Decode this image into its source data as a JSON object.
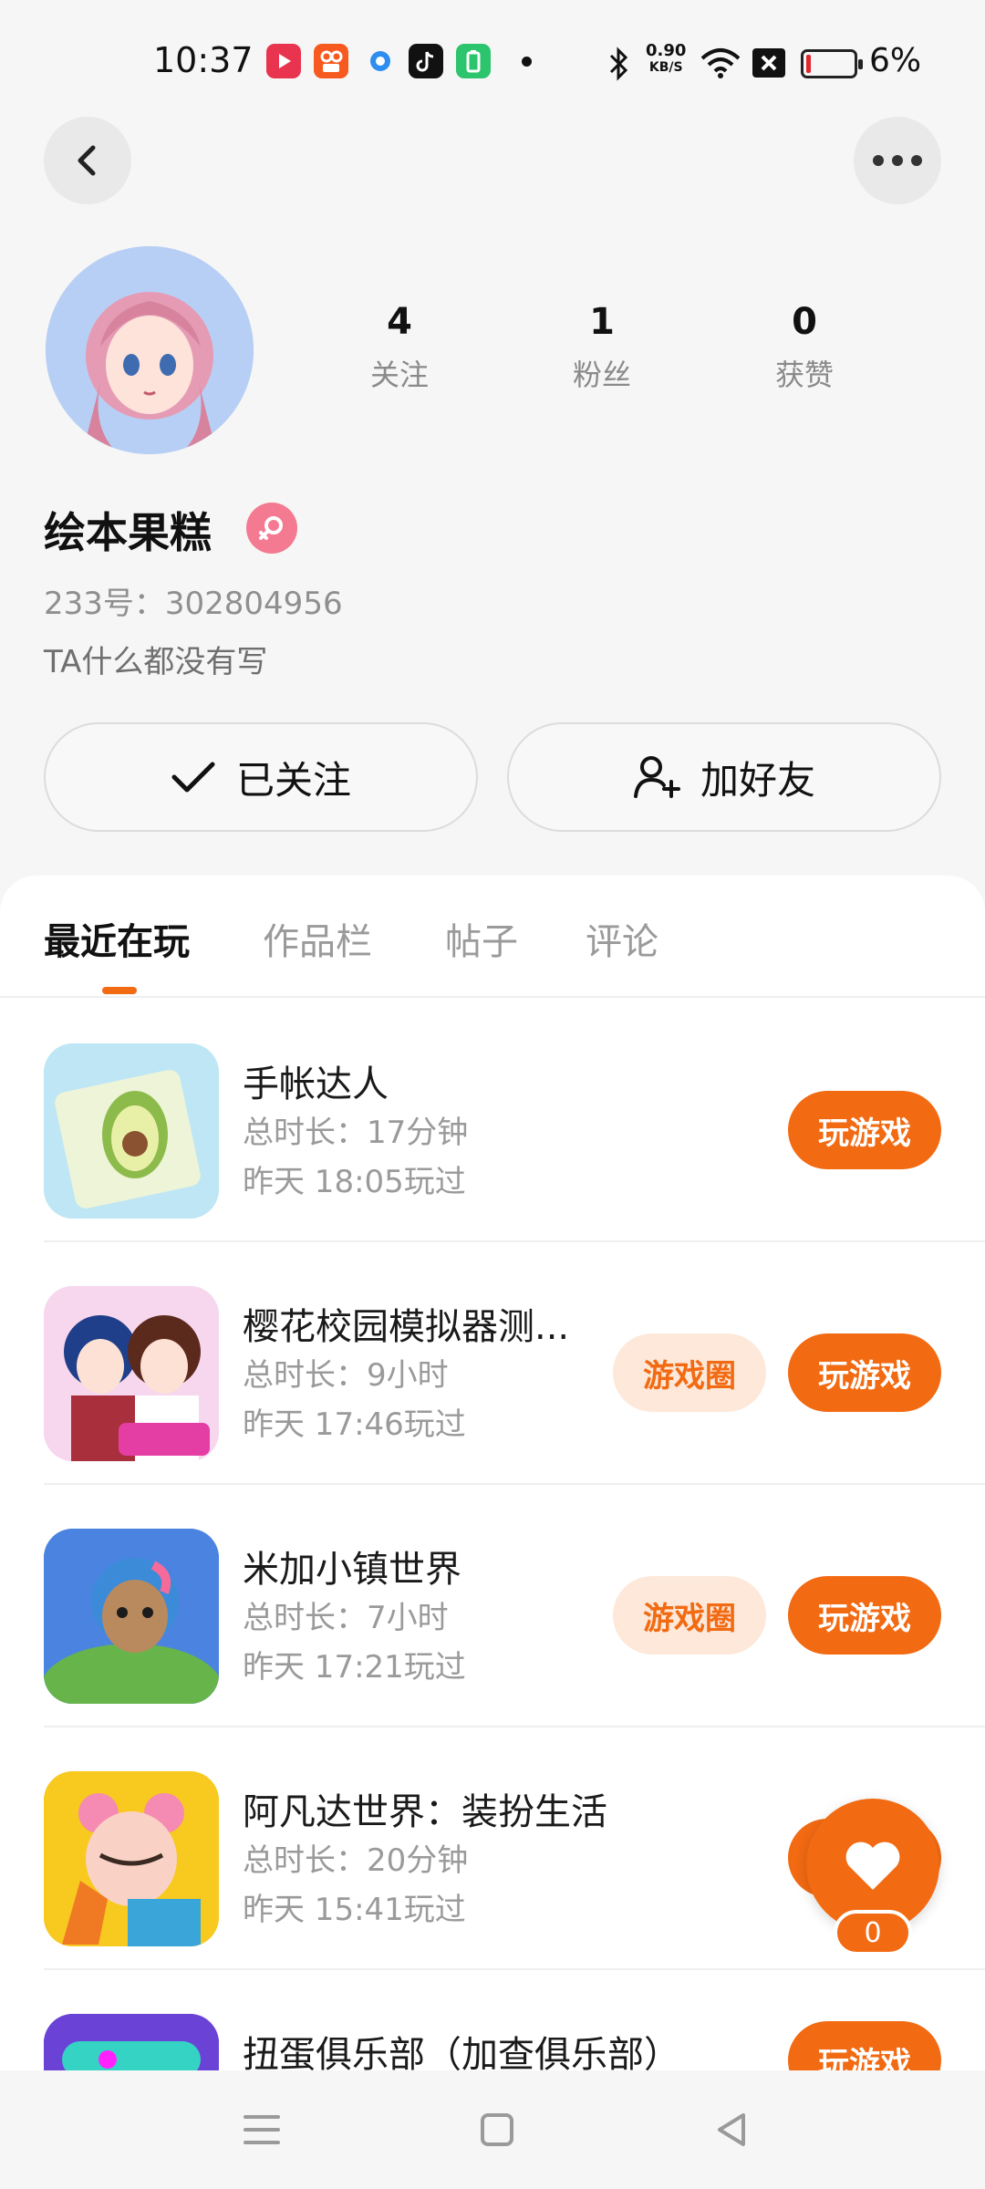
{
  "status_bar": {
    "time": "10:37",
    "net_speed_value": "0.90",
    "net_speed_unit": "KB/S",
    "battery_percent": "6%",
    "battery_level": 0.06,
    "icons": [
      "bluetooth-icon",
      "wifi-icon",
      "sim-off-icon",
      "battery-icon"
    ],
    "colors": {
      "battery_low": "#e0262c"
    }
  },
  "header": {
    "back_icon": "chevron-left-icon",
    "more_icon": "more-dots-icon"
  },
  "profile": {
    "name": "绘本果糕",
    "gender_icon": "female-icon",
    "uid": "233号：302804956",
    "bio": "TA什么都没有写",
    "stats": [
      {
        "value": "4",
        "label": "关注"
      },
      {
        "value": "1",
        "label": "粉丝"
      },
      {
        "value": "0",
        "label": "获赞"
      }
    ],
    "follow_label": "已关注",
    "add_friend_label": "加好友"
  },
  "tabs": [
    "最近在玩",
    "作品栏",
    "帖子",
    "评论"
  ],
  "active_tab": 0,
  "games": [
    {
      "name": "手帐达人",
      "duration": "总时长：17分钟",
      "last_played": "昨天 18:05玩过",
      "has_circle": false
    },
    {
      "name": "樱花校园模拟器测...",
      "duration": "总时长：9小时",
      "last_played": "昨天 17:46玩过",
      "has_circle": true
    },
    {
      "name": "米加小镇世界",
      "duration": "总时长：7小时",
      "last_played": "昨天 17:21玩过",
      "has_circle": true
    },
    {
      "name": "阿凡达世界：装扮生活",
      "duration": "总时长：20分钟",
      "last_played": "昨天 15:41玩过",
      "has_circle": false
    },
    {
      "name": "扭蛋俱乐部（加查俱乐部）",
      "duration": "",
      "last_played": "",
      "has_circle": false
    }
  ],
  "buttons": {
    "play_label": "玩游戏",
    "circle_label": "游戏圈"
  },
  "like": {
    "count": "0",
    "icon": "heart-icon"
  },
  "colors": {
    "accent": "#f26a12",
    "accent_light": "#fde8da",
    "gender_pink": "#f47a92"
  },
  "nav": [
    "menu-icon",
    "home-square-icon",
    "back-triangle-icon"
  ]
}
